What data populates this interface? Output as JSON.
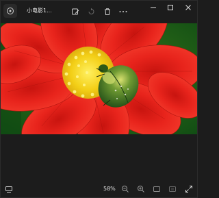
{
  "window": {
    "title": "小电影1..."
  },
  "toolbar": {
    "icons": [
      "edit-image-icon",
      "rotate-icon",
      "delete-icon",
      "more-icon"
    ]
  },
  "window_controls": [
    "minimize-icon",
    "maximize-icon",
    "close-icon"
  ],
  "status": {
    "zoom": "58%"
  },
  "colors": {
    "background": "#1c1c1c",
    "petal": "#e0201c",
    "center": "#f0d020",
    "beetle": "#2e6a1e",
    "foliage": "#1e6b1e"
  }
}
